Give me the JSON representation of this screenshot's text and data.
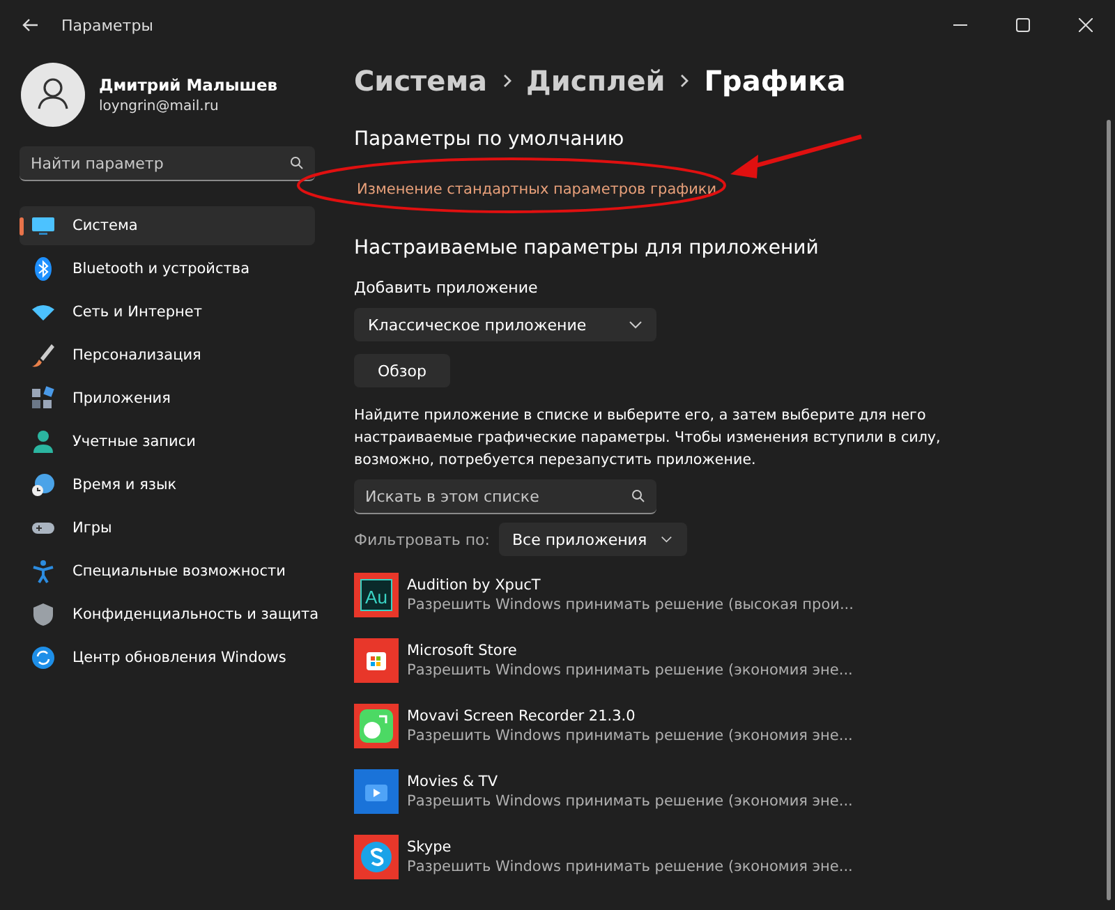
{
  "window": {
    "title": "Параметры"
  },
  "user": {
    "name": "Дмитрий Малышев",
    "email": "loyngrin@mail.ru"
  },
  "sidebar": {
    "search": {
      "placeholder": "Найти параметр"
    },
    "items": [
      {
        "label": "Система",
        "kind": "system",
        "selected": true
      },
      {
        "label": "Bluetooth и устройства",
        "kind": "bluetooth",
        "selected": false
      },
      {
        "label": "Сеть и Интернет",
        "kind": "network",
        "selected": false
      },
      {
        "label": "Персонализация",
        "kind": "brush",
        "selected": false
      },
      {
        "label": "Приложения",
        "kind": "apps",
        "selected": false
      },
      {
        "label": "Учетные записи",
        "kind": "account",
        "selected": false
      },
      {
        "label": "Время и язык",
        "kind": "time",
        "selected": false
      },
      {
        "label": "Игры",
        "kind": "games",
        "selected": false
      },
      {
        "label": "Специальные возможности",
        "kind": "accessibility",
        "selected": false
      },
      {
        "label": "Конфиденциальность и защита",
        "kind": "shield",
        "selected": false
      },
      {
        "label": "Центр обновления Windows",
        "kind": "update",
        "selected": false
      }
    ]
  },
  "breadcrumb": [
    "Система",
    "Дисплей",
    "Графика"
  ],
  "defaults": {
    "heading": "Параметры по умолчанию",
    "link": "Изменение стандартных параметров графики"
  },
  "custom": {
    "heading": "Настраиваемые параметры для приложений",
    "add_label": "Добавить приложение",
    "app_type": "Классическое приложение",
    "browse": "Обзор",
    "description": "Найдите приложение в списке и выберите его, а затем выберите для него настраиваемые графические параметры. Чтобы изменения вступили в силу, возможно, потребуется перезапустить приложение.",
    "search": {
      "placeholder": "Искать в этом списке"
    },
    "filter_label": "Фильтровать по:",
    "filter_value": "Все приложения"
  },
  "apps": [
    {
      "name": "Audition by XpucT",
      "setting": "Разрешить Windows принимать решение (высокая прои...",
      "kind": "audition",
      "icon_text": "Au"
    },
    {
      "name": "Microsoft Store",
      "setting": "Разрешить Windows принимать решение (экономия эне...",
      "kind": "store"
    },
    {
      "name": "Movavi Screen Recorder 21.3.0",
      "setting": "Разрешить Windows принимать решение (экономия эне...",
      "kind": "movavi"
    },
    {
      "name": "Movies & TV",
      "setting": "Разрешить Windows принимать решение (экономия эне...",
      "kind": "movies"
    },
    {
      "name": "Skype",
      "setting": "Разрешить Windows принимать решение (экономия эне...",
      "kind": "skype"
    }
  ]
}
